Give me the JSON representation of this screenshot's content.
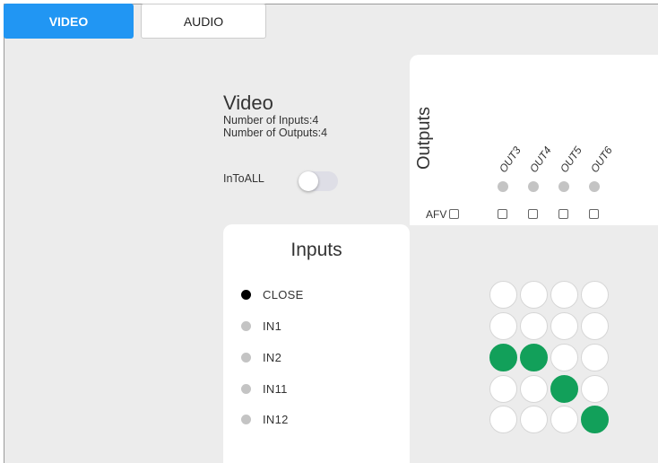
{
  "tabs": [
    {
      "label": "VIDEO",
      "active": true
    },
    {
      "label": "AUDIO",
      "active": false
    }
  ],
  "info": {
    "title": "Video",
    "inputs_count": "Number of Inputs:4",
    "outputs_count": "Number of Outputs:4",
    "into_all_label": "InToALL",
    "into_all_on": false
  },
  "outputs": {
    "title": "Outputs",
    "afv_label": "AFV",
    "columns": [
      "OUT3",
      "OUT4",
      "OUT5",
      "OUT6"
    ]
  },
  "inputs": {
    "title": "Inputs",
    "rows": [
      {
        "label": "CLOSE",
        "selected": true
      },
      {
        "label": "IN1",
        "selected": false
      },
      {
        "label": "IN2",
        "selected": false
      },
      {
        "label": "IN11",
        "selected": false
      },
      {
        "label": "IN12",
        "selected": false
      }
    ]
  },
  "matrix": [
    [
      false,
      false,
      false,
      false
    ],
    [
      false,
      false,
      false,
      false
    ],
    [
      true,
      true,
      false,
      false
    ],
    [
      false,
      false,
      true,
      false
    ],
    [
      false,
      false,
      false,
      true
    ]
  ],
  "colors": {
    "accent": "#2196f3",
    "route_on": "#12a05a",
    "selected_dot": "#000000",
    "idle_dot": "#c4c4c4"
  }
}
